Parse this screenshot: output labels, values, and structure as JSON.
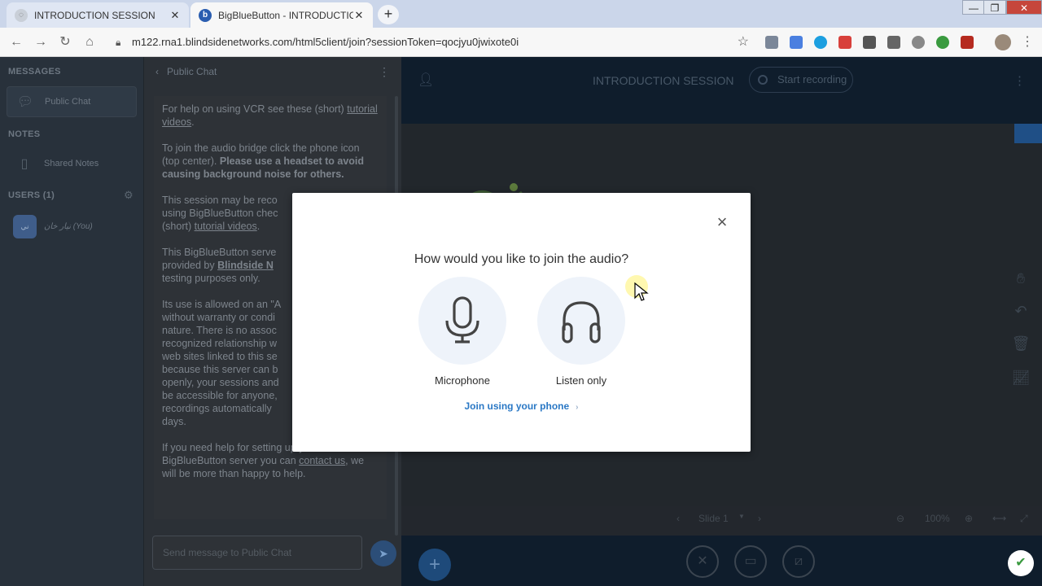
{
  "browser": {
    "tabs": [
      {
        "title": "INTRODUCTION SESSION",
        "active": false
      },
      {
        "title": "BigBlueButton - INTRODUCTION",
        "active": true,
        "favicon_letter": "b"
      }
    ],
    "url": "m122.rna1.blindsidenetworks.com/html5client/join?sessionToken=qocjyu0jwixote0i",
    "window_controls": {
      "minimize": "—",
      "restore": "❐",
      "close": "✕"
    }
  },
  "sidebar": {
    "messages_label": "MESSAGES",
    "public_chat": "Public Chat",
    "notes_label": "NOTES",
    "shared_notes": "Shared Notes",
    "users_label": "USERS (1)",
    "user": {
      "avatar": "ني",
      "name": "نيار خان (You)"
    }
  },
  "chat": {
    "header": "Public Chat",
    "welcome": {
      "p1_a": "For help on using VCR see these (short) ",
      "p1_link": "tutorial videos",
      "p1_b": ".",
      "p2_a": "To join the audio bridge click the phone icon (top center). ",
      "p2_bold": "Please use a headset to avoid causing background noise for others.",
      "p3_a": "This session may be reco",
      "p3_b": "using BigBlueButton chec",
      "p3_c": "(short) ",
      "p3_link": "tutorial videos",
      "p3_d": ".",
      "p4_a": "This BigBlueButton serve",
      "p4_b": "provided by ",
      "p4_link": "Blindside N",
      "p4_c": "testing purposes only.",
      "p5_lines": [
        "Its use is allowed on an \"A",
        "without warranty or condi",
        "nature. There is no assoc",
        "recognized relationship w",
        "web sites linked to this se",
        "because this server can b",
        "openly, your sessions and",
        "be accessible for anyone,",
        "recordings automatically",
        "days."
      ],
      "p6_a": "If you need help for setting up your own BigBlueButton server you can ",
      "p6_link": "contact us",
      "p6_b": ", we will be more than happy to help."
    },
    "input_placeholder": "Send message to Public Chat"
  },
  "main": {
    "session_title": "INTRODUCTION SESSION",
    "start_recording": "Start recording",
    "slide_label": "Slide 1",
    "zoom": "100%"
  },
  "modal": {
    "title": "How would you like to join the audio?",
    "microphone_label": "Microphone",
    "listen_only_label": "Listen only",
    "phone_link": "Join using your phone",
    "close_symbol": "×"
  },
  "colors": {
    "modal_link": "#2a78c5",
    "option_circle": "#eef3fa",
    "topbar": "#0f1d2c"
  }
}
